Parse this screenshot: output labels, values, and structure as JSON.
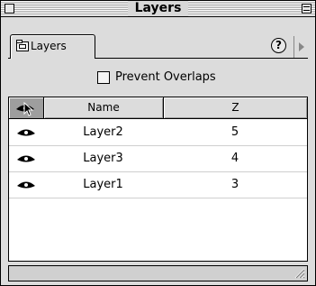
{
  "window": {
    "title": "Layers"
  },
  "tabs": [
    {
      "label": "Layers",
      "icon": "layers-folder-icon"
    }
  ],
  "toolbar": {
    "help_label": "?"
  },
  "options": {
    "prevent_overlaps_label": "Prevent Overlaps",
    "prevent_overlaps_checked": false
  },
  "table": {
    "columns": {
      "eye": "",
      "name": "Name",
      "z": "Z"
    },
    "rows": [
      {
        "visible": true,
        "name": "Layer2",
        "z": "5"
      },
      {
        "visible": true,
        "name": "Layer3",
        "z": "4"
      },
      {
        "visible": true,
        "name": "Layer1",
        "z": "3"
      }
    ]
  }
}
